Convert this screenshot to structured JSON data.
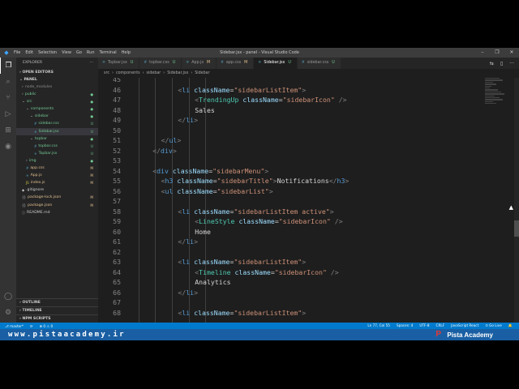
{
  "titlebar": {
    "menu": [
      "File",
      "Edit",
      "Selection",
      "View",
      "Go",
      "Run",
      "Terminal",
      "Help"
    ],
    "window_title": "Sidebar.jsx - panel - Visual Studio Code",
    "controls": [
      "–",
      "❐",
      "✕"
    ]
  },
  "activity": [
    "files-icon",
    "search-icon",
    "source-control-icon",
    "run-debug-icon",
    "extensions-icon",
    "remote-icon",
    "account-icon",
    "settings-icon"
  ],
  "explorer": {
    "header": "EXPLORER",
    "dots": "···",
    "open_editors": "OPEN EDITORS",
    "project": "PANEL",
    "tree": [
      {
        "indent": 1,
        "chev": "›",
        "icon": "",
        "label": "node_modules",
        "status": "",
        "color": "ignored"
      },
      {
        "indent": 1,
        "chev": "›",
        "icon": "",
        "label": "public",
        "status": "●",
        "color": "untracked"
      },
      {
        "indent": 1,
        "chev": "⌄",
        "icon": "",
        "label": "src",
        "status": "●",
        "color": "untracked"
      },
      {
        "indent": 2,
        "chev": "⌄",
        "icon": "",
        "label": "components",
        "status": "●",
        "color": "untracked"
      },
      {
        "indent": 3,
        "chev": "⌄",
        "icon": "",
        "label": "sidebar",
        "status": "●",
        "color": "untracked"
      },
      {
        "indent": 4,
        "chev": "",
        "icon": "#",
        "label": "sidebar.css",
        "status": "U",
        "color": "untracked"
      },
      {
        "indent": 4,
        "chev": "",
        "icon": "⚛",
        "label": "Sidebar.jsx",
        "status": "U",
        "color": "untracked",
        "selected": true
      },
      {
        "indent": 3,
        "chev": "⌄",
        "icon": "",
        "label": "topbar",
        "status": "●",
        "color": "untracked"
      },
      {
        "indent": 4,
        "chev": "",
        "icon": "#",
        "label": "topbar.css",
        "status": "U",
        "color": "untracked"
      },
      {
        "indent": 4,
        "chev": "",
        "icon": "⚛",
        "label": "Topbar.jsx",
        "status": "U",
        "color": "untracked"
      },
      {
        "indent": 2,
        "chev": "›",
        "icon": "",
        "label": "img",
        "status": "●",
        "color": "untracked"
      },
      {
        "indent": 2,
        "chev": "",
        "icon": "#",
        "label": "app.css",
        "status": "M",
        "color": "modified"
      },
      {
        "indent": 2,
        "chev": "",
        "icon": "⚛",
        "label": "App.js",
        "status": "M",
        "color": "modified"
      },
      {
        "indent": 2,
        "chev": "",
        "icon": "JS",
        "label": "index.js",
        "status": "M",
        "color": "modified"
      },
      {
        "indent": 1,
        "chev": "",
        "icon": "◆",
        "label": ".gitignore",
        "status": "",
        "color": "plain"
      },
      {
        "indent": 1,
        "chev": "",
        "icon": "{}",
        "label": "package-lock.json",
        "status": "M",
        "color": "modified"
      },
      {
        "indent": 1,
        "chev": "",
        "icon": "{}",
        "label": "package.json",
        "status": "M",
        "color": "modified"
      },
      {
        "indent": 1,
        "chev": "",
        "icon": "ⓘ",
        "label": "README.md",
        "status": "",
        "color": "plain"
      }
    ],
    "bottom_sections": [
      "OUTLINE",
      "TIMELINE",
      "NPM SCRIPTS"
    ]
  },
  "tabs": [
    {
      "icon": "⚛",
      "label": "Topbar.jsx",
      "status": "U",
      "active": false
    },
    {
      "icon": "#",
      "label": "topbar.css",
      "status": "U",
      "active": false
    },
    {
      "icon": "⚛",
      "label": "App.js",
      "status": "M",
      "active": false
    },
    {
      "icon": "#",
      "label": "app.css",
      "status": "M",
      "active": false
    },
    {
      "icon": "⚛",
      "label": "Sidebar.jsx",
      "status": "U",
      "active": true
    },
    {
      "icon": "#",
      "label": "sidebar.css",
      "status": "U",
      "active": false
    }
  ],
  "tab_actions": [
    "⇆",
    "▯",
    "···"
  ],
  "breadcrumb": [
    "src",
    "components",
    "sidebar",
    "Sidebar.jsx",
    "Sidebar"
  ],
  "code": [
    {
      "n": "45",
      "indent": 0,
      "tokens": []
    },
    {
      "n": "46",
      "indent": 6,
      "tokens": [
        [
          "br",
          "<"
        ],
        [
          "tag",
          "li"
        ],
        [
          "txt",
          " "
        ],
        [
          "attr",
          "className"
        ],
        [
          "txt",
          "="
        ],
        [
          "str",
          "\"sidebarListItem\""
        ],
        [
          "br",
          ">"
        ]
      ]
    },
    {
      "n": "47",
      "indent": 8,
      "tokens": [
        [
          "br",
          "<"
        ],
        [
          "comp",
          "TrendingUp"
        ],
        [
          "txt",
          " "
        ],
        [
          "attr",
          "className"
        ],
        [
          "txt",
          "="
        ],
        [
          "str",
          "\"sidebarIcon\""
        ],
        [
          "txt",
          " "
        ],
        [
          "br",
          "/>"
        ]
      ]
    },
    {
      "n": "48",
      "indent": 8,
      "tokens": [
        [
          "txt",
          "Sales"
        ]
      ]
    },
    {
      "n": "49",
      "indent": 6,
      "tokens": [
        [
          "br",
          "</"
        ],
        [
          "tag",
          "li"
        ],
        [
          "br",
          ">"
        ]
      ]
    },
    {
      "n": "50",
      "indent": 0,
      "tokens": []
    },
    {
      "n": "51",
      "indent": 4,
      "tokens": [
        [
          "br",
          "</"
        ],
        [
          "tag",
          "ul"
        ],
        [
          "br",
          ">"
        ]
      ]
    },
    {
      "n": "52",
      "indent": 3,
      "tokens": [
        [
          "br",
          "</"
        ],
        [
          "tag",
          "div"
        ],
        [
          "br",
          ">"
        ]
      ]
    },
    {
      "n": "53",
      "indent": 0,
      "tokens": []
    },
    {
      "n": "54",
      "indent": 3,
      "tokens": [
        [
          "br",
          "<"
        ],
        [
          "tag",
          "div"
        ],
        [
          "txt",
          " "
        ],
        [
          "attr",
          "className"
        ],
        [
          "txt",
          "="
        ],
        [
          "str",
          "\"sidebarMenu\""
        ],
        [
          "br",
          ">"
        ]
      ]
    },
    {
      "n": "55",
      "indent": 4,
      "tokens": [
        [
          "br",
          "<"
        ],
        [
          "tag",
          "h3"
        ],
        [
          "txt",
          " "
        ],
        [
          "attr",
          "className"
        ],
        [
          "txt",
          "="
        ],
        [
          "str",
          "\"sidebarTitle\""
        ],
        [
          "br",
          ">"
        ],
        [
          "txt",
          "Notifications"
        ],
        [
          "br",
          "</"
        ],
        [
          "tag",
          "h3"
        ],
        [
          "br",
          ">"
        ]
      ]
    },
    {
      "n": "56",
      "indent": 4,
      "tokens": [
        [
          "br",
          "<"
        ],
        [
          "tag",
          "ul"
        ],
        [
          "txt",
          " "
        ],
        [
          "attr",
          "className"
        ],
        [
          "txt",
          "="
        ],
        [
          "str",
          "\"sidebarList\""
        ],
        [
          "br",
          ">"
        ]
      ]
    },
    {
      "n": "57",
      "indent": 0,
      "tokens": []
    },
    {
      "n": "58",
      "indent": 6,
      "tokens": [
        [
          "br",
          "<"
        ],
        [
          "tag",
          "li"
        ],
        [
          "txt",
          " "
        ],
        [
          "attr",
          "className"
        ],
        [
          "txt",
          "="
        ],
        [
          "str",
          "\"sidebarListItem active\""
        ],
        [
          "br",
          ">"
        ]
      ]
    },
    {
      "n": "59",
      "indent": 8,
      "tokens": [
        [
          "br",
          "<"
        ],
        [
          "comp",
          "LineStyle"
        ],
        [
          "txt",
          " "
        ],
        [
          "attr",
          "className"
        ],
        [
          "txt",
          "="
        ],
        [
          "str",
          "\"sidebarIcon\""
        ],
        [
          "txt",
          " "
        ],
        [
          "br",
          "/>"
        ]
      ]
    },
    {
      "n": "60",
      "indent": 8,
      "tokens": [
        [
          "txt",
          "Home"
        ]
      ]
    },
    {
      "n": "61",
      "indent": 6,
      "tokens": [
        [
          "br",
          "</"
        ],
        [
          "tag",
          "li"
        ],
        [
          "br",
          ">"
        ]
      ]
    },
    {
      "n": "62",
      "indent": 0,
      "tokens": []
    },
    {
      "n": "63",
      "indent": 6,
      "tokens": [
        [
          "br",
          "<"
        ],
        [
          "tag",
          "li"
        ],
        [
          "txt",
          " "
        ],
        [
          "attr",
          "className"
        ],
        [
          "txt",
          "="
        ],
        [
          "str",
          "\"sidebarListItem\""
        ],
        [
          "br",
          ">"
        ]
      ]
    },
    {
      "n": "64",
      "indent": 8,
      "tokens": [
        [
          "br",
          "<"
        ],
        [
          "comp",
          "Timeline"
        ],
        [
          "txt",
          " "
        ],
        [
          "attr",
          "className"
        ],
        [
          "txt",
          "="
        ],
        [
          "str",
          "\"sidebarIcon\""
        ],
        [
          "txt",
          " "
        ],
        [
          "br",
          "/>"
        ]
      ]
    },
    {
      "n": "65",
      "indent": 8,
      "tokens": [
        [
          "txt",
          "Analytics"
        ]
      ]
    },
    {
      "n": "66",
      "indent": 6,
      "tokens": [
        [
          "br",
          "</"
        ],
        [
          "tag",
          "li"
        ],
        [
          "br",
          ">"
        ]
      ]
    },
    {
      "n": "67",
      "indent": 0,
      "tokens": []
    },
    {
      "n": "68",
      "indent": 6,
      "tokens": [
        [
          "br",
          "<"
        ],
        [
          "tag",
          "li"
        ],
        [
          "txt",
          " "
        ],
        [
          "attr",
          "className"
        ],
        [
          "txt",
          "="
        ],
        [
          "str",
          "\"sidebarListItem\""
        ],
        [
          "br",
          ">"
        ]
      ]
    }
  ],
  "statusbar": {
    "left": [
      "⎇ master*",
      "⟳",
      "⊗ 0 ⚠ 0"
    ],
    "right": [
      "Ln 77, Col 55",
      "Spaces: 4",
      "UTF-8",
      "CRLF",
      "JavaScript React",
      "⊙ Go Live",
      "🔔"
    ]
  },
  "banner": {
    "url": "www.pistaacademy.ir",
    "brand": "Pista Academy",
    "logo_glyph": "P"
  },
  "colors": {
    "accent": "#007acc",
    "banner": "#1a5fa3",
    "untracked": "#73c991",
    "modified": "#e2c08d"
  }
}
